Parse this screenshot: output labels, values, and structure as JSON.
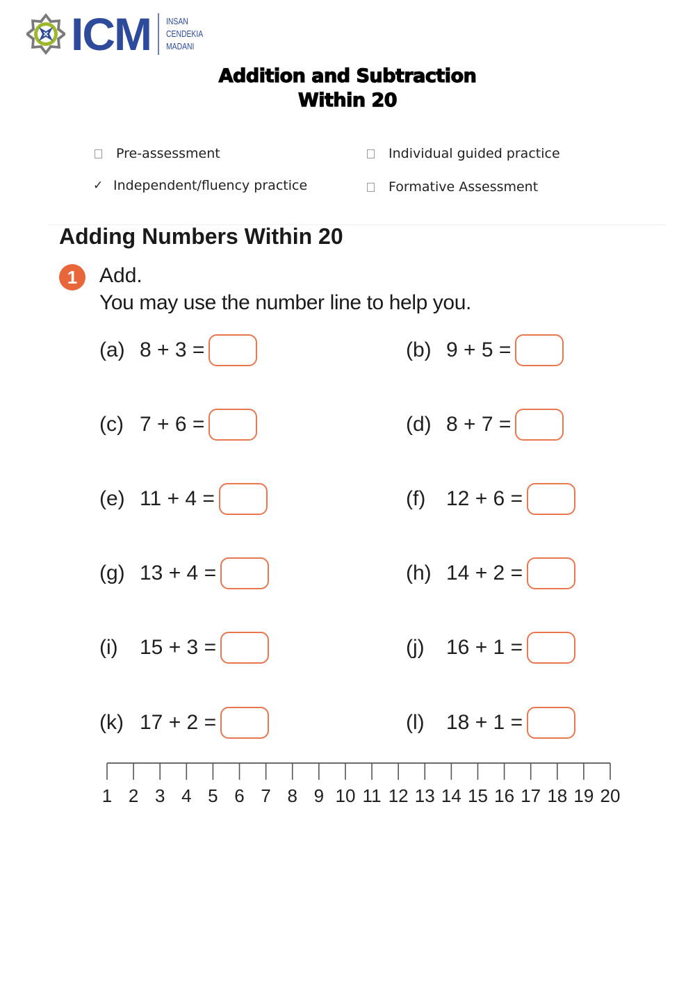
{
  "logo": {
    "icon": "star-emblem-icon",
    "text": "ICM",
    "subtitle_lines": [
      "INSAN",
      "CENDEKIA",
      "MADANI"
    ],
    "colors": {
      "brand_blue": "#2e4a9a",
      "emblem_green": "#9db92b",
      "emblem_gray": "#7a7a7a"
    }
  },
  "title": {
    "line1": "Addition and Subtraction",
    "line2": "Within 20"
  },
  "checklist": [
    {
      "label": "Pre-assessment",
      "checked": false,
      "mark": ""
    },
    {
      "label": "Individual guided practice",
      "checked": false,
      "mark": ""
    },
    {
      "label": "Independent/fluency practice",
      "checked": true,
      "mark": "✓"
    },
    {
      "label": "Formative Assessment",
      "checked": false,
      "mark": ""
    }
  ],
  "section": {
    "title": "Adding Numbers Within 20",
    "question_number": "1",
    "instruction_line1": "Add.",
    "instruction_line2": "You may use the number line to help you.",
    "accent_color": "#e8673a"
  },
  "problems": [
    {
      "label": "(a)",
      "expression": "8 + 3 =",
      "answer": ""
    },
    {
      "label": "(b)",
      "expression": "9 + 5 =",
      "answer": ""
    },
    {
      "label": "(c)",
      "expression": "7 + 6 =",
      "answer": ""
    },
    {
      "label": "(d)",
      "expression": "8 + 7 =",
      "answer": ""
    },
    {
      "label": "(e)",
      "expression": "11 + 4 =",
      "answer": ""
    },
    {
      "label": "(f)",
      "expression": "12 + 6 =",
      "answer": ""
    },
    {
      "label": "(g)",
      "expression": "13 + 4 =",
      "answer": ""
    },
    {
      "label": "(h)",
      "expression": "14 + 2 =",
      "answer": ""
    },
    {
      "label": "(i)",
      "expression": "15 + 3 =",
      "answer": ""
    },
    {
      "label": "(j)",
      "expression": "16 + 1 =",
      "answer": ""
    },
    {
      "label": "(k)",
      "expression": "17 + 2 =",
      "answer": ""
    },
    {
      "label": "(l)",
      "expression": "18 + 1 =",
      "answer": ""
    }
  ],
  "number_line": {
    "start": 1,
    "end": 20,
    "labels": [
      "1",
      "2",
      "3",
      "4",
      "5",
      "6",
      "7",
      "8",
      "9",
      "10",
      "11",
      "12",
      "13",
      "14",
      "15",
      "16",
      "17",
      "18",
      "19",
      "20"
    ]
  }
}
